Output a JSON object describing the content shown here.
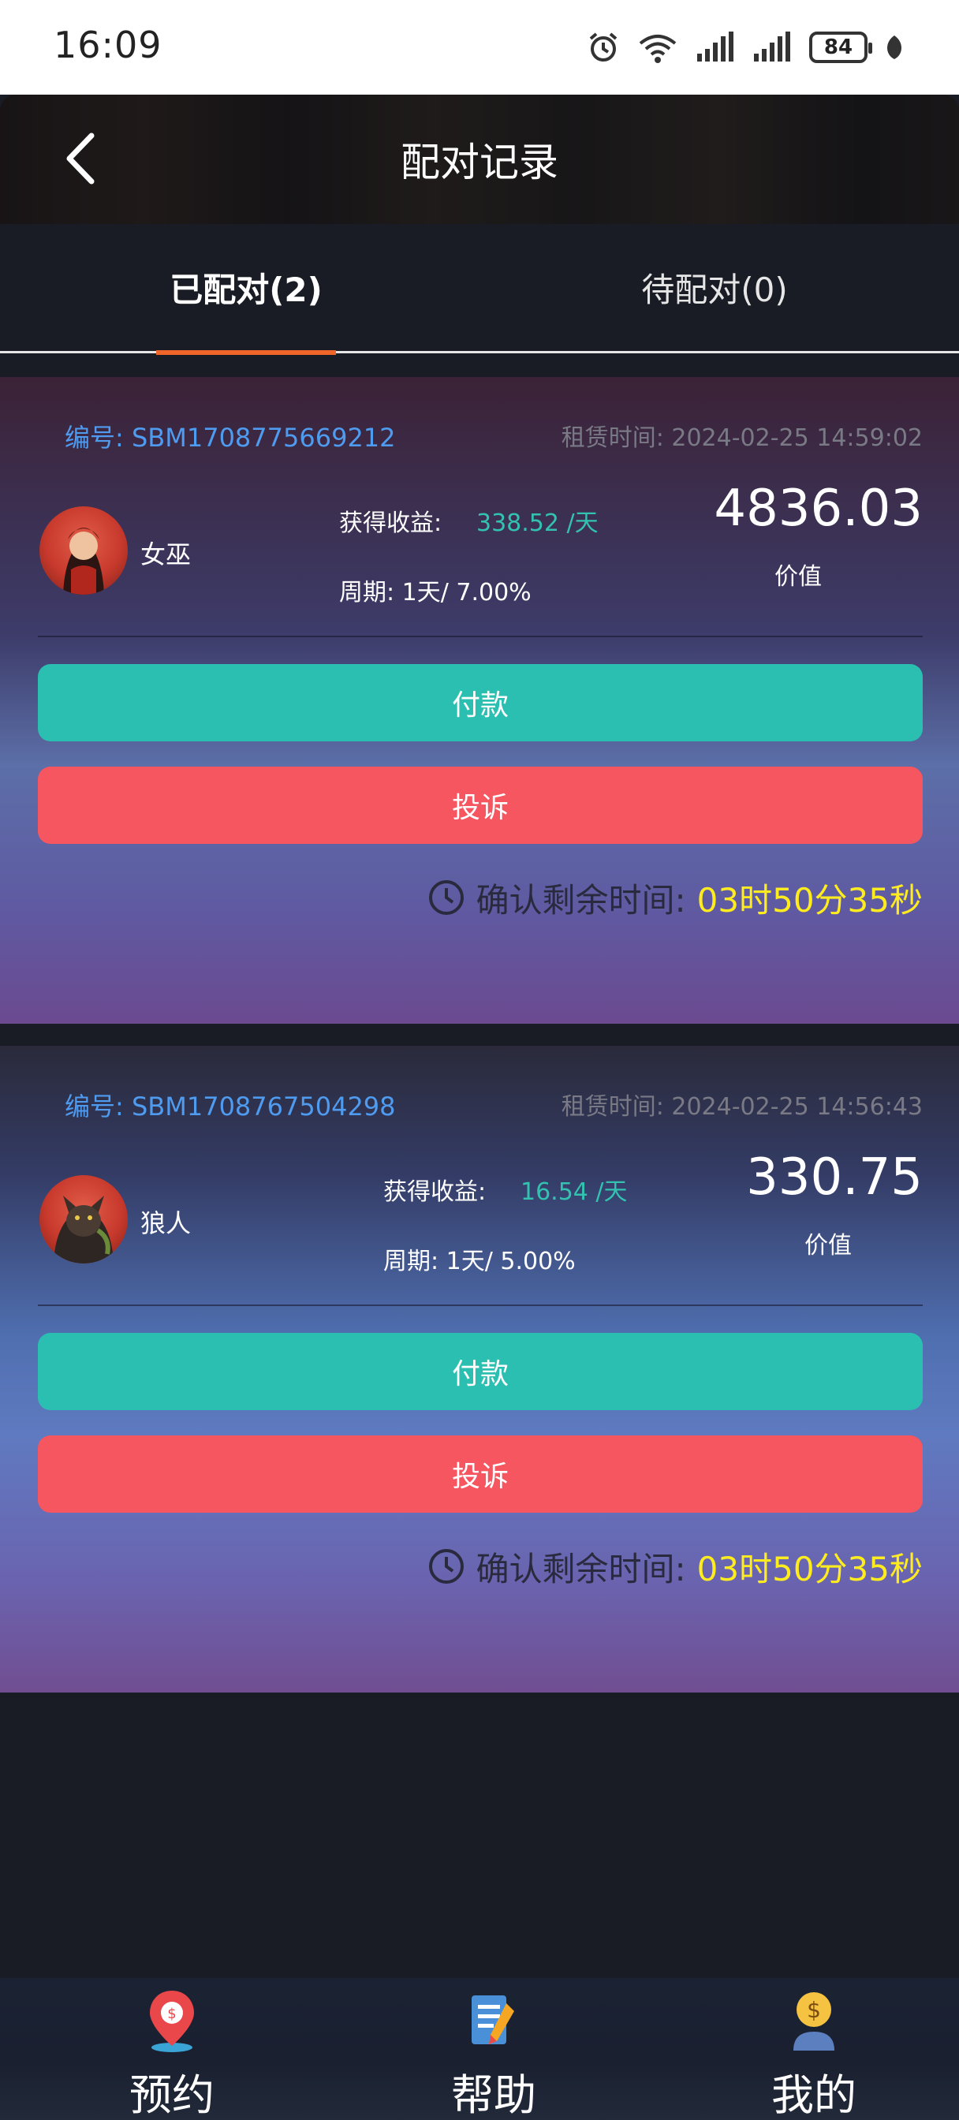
{
  "status_bar": {
    "time": "16:09",
    "battery": "84"
  },
  "header": {
    "title": "配对记录"
  },
  "tabs": [
    {
      "label": "已配对(2)"
    },
    {
      "label": "待配对(0)"
    }
  ],
  "records": [
    {
      "order_label": "编号:",
      "order_no": "SBM1708775669212",
      "rent_label": "租赁时间:",
      "rent_time": "2024-02-25 14:59:02",
      "name": "女巫",
      "earn_label": "获得收益:",
      "earn_value": "338.52 /天",
      "period": "周期: 1天/ 7.00%",
      "value": "4836.03",
      "value_label": "价值",
      "pay_label": "付款",
      "complain_label": "投诉",
      "countdown_label": "确认剩余时间:",
      "countdown_value": "03时50分35秒"
    },
    {
      "order_label": "编号:",
      "order_no": "SBM1708767504298",
      "rent_label": "租赁时间:",
      "rent_time": "2024-02-25 14:56:43",
      "name": "狼人",
      "earn_label": "获得收益:",
      "earn_value": "16.54 /天",
      "period": "周期: 1天/ 5.00%",
      "value": "330.75",
      "value_label": "价值",
      "pay_label": "付款",
      "complain_label": "投诉",
      "countdown_label": "确认剩余时间:",
      "countdown_value": "03时50分35秒"
    }
  ],
  "bottom_nav": [
    {
      "label": "预约",
      "icon": "location-pin-icon"
    },
    {
      "label": "帮助",
      "icon": "document-edit-icon"
    },
    {
      "label": "我的",
      "icon": "user-dollar-icon"
    }
  ],
  "colors": {
    "accent_tab": "#f0652a",
    "pay": "#2bbfb1",
    "complain": "#f55660",
    "countdown": "#ffec1f",
    "order_no": "#4f9bf0"
  }
}
